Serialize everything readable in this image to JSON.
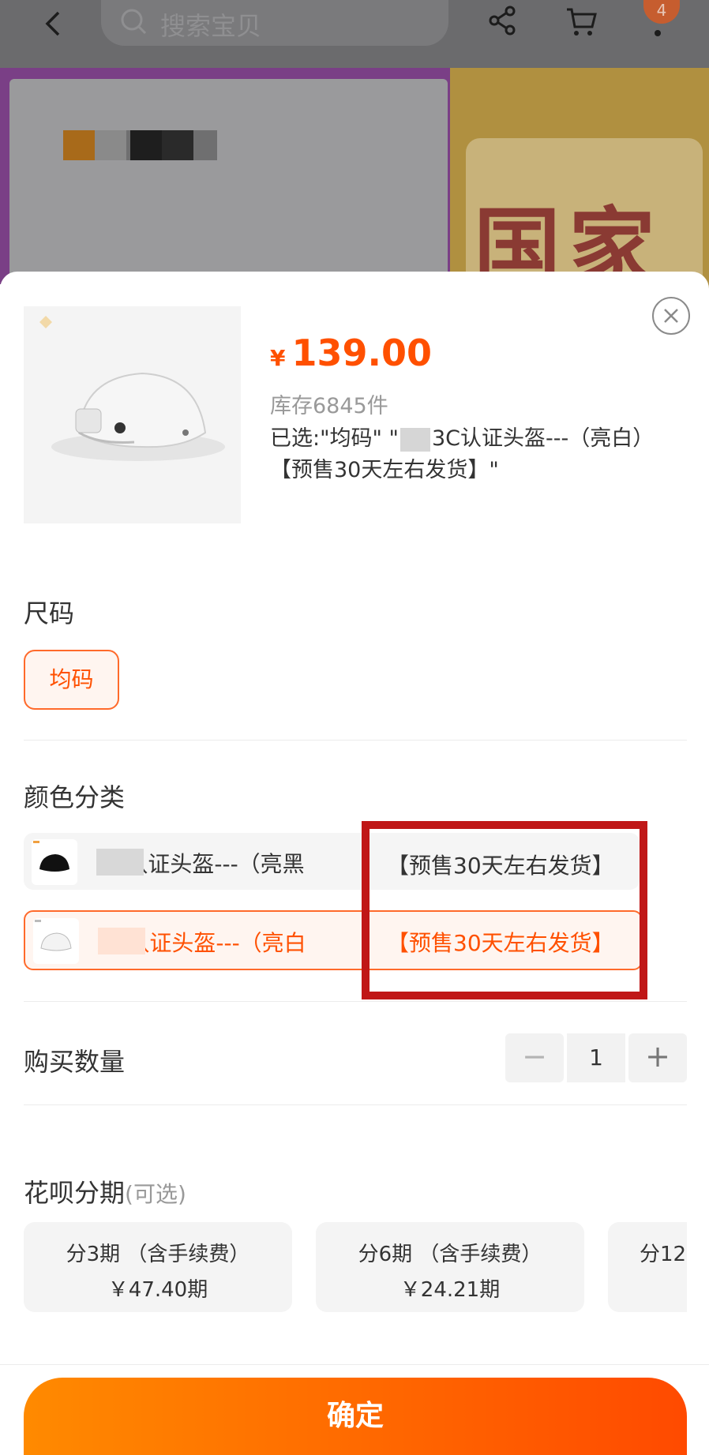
{
  "topbar": {
    "search_placeholder": "搜索宝贝",
    "cart_badge": "4"
  },
  "background": {
    "hero_text": "国家"
  },
  "product": {
    "price_symbol": "¥",
    "price": "139.00",
    "stock": "库存6845件",
    "selected_line1": "已选:\"均码\" \"",
    "selected_line1b": "3C认证头盔---（亮白）",
    "selected_line2": "【预售30天左右发货】\""
  },
  "size": {
    "title": "尺码",
    "option": "均码"
  },
  "color": {
    "title": "颜色分类",
    "options": [
      {
        "label": "3C认证头盔---（亮黑",
        "presale": "【预售30天左右发货】",
        "icon": "black-helmet"
      },
      {
        "label": "3C认证头盔---（亮白",
        "presale": "【预售30天左右发货】",
        "icon": "white-helmet"
      }
    ]
  },
  "quantity": {
    "title": "购买数量",
    "minus": "−",
    "value": "1",
    "plus": "+"
  },
  "installment": {
    "title": "花呗分期",
    "optional": "(可选)",
    "plans": [
      {
        "line1": "分3期 （含手续费）",
        "line2": "￥47.40期"
      },
      {
        "line1": "分6期 （含手续费）",
        "line2": "￥24.21期"
      },
      {
        "line1": "分12",
        "line2": ""
      }
    ]
  },
  "confirm_label": "确定",
  "colors": {
    "accent": "#ff5000",
    "highlight_box": "#c01717"
  }
}
